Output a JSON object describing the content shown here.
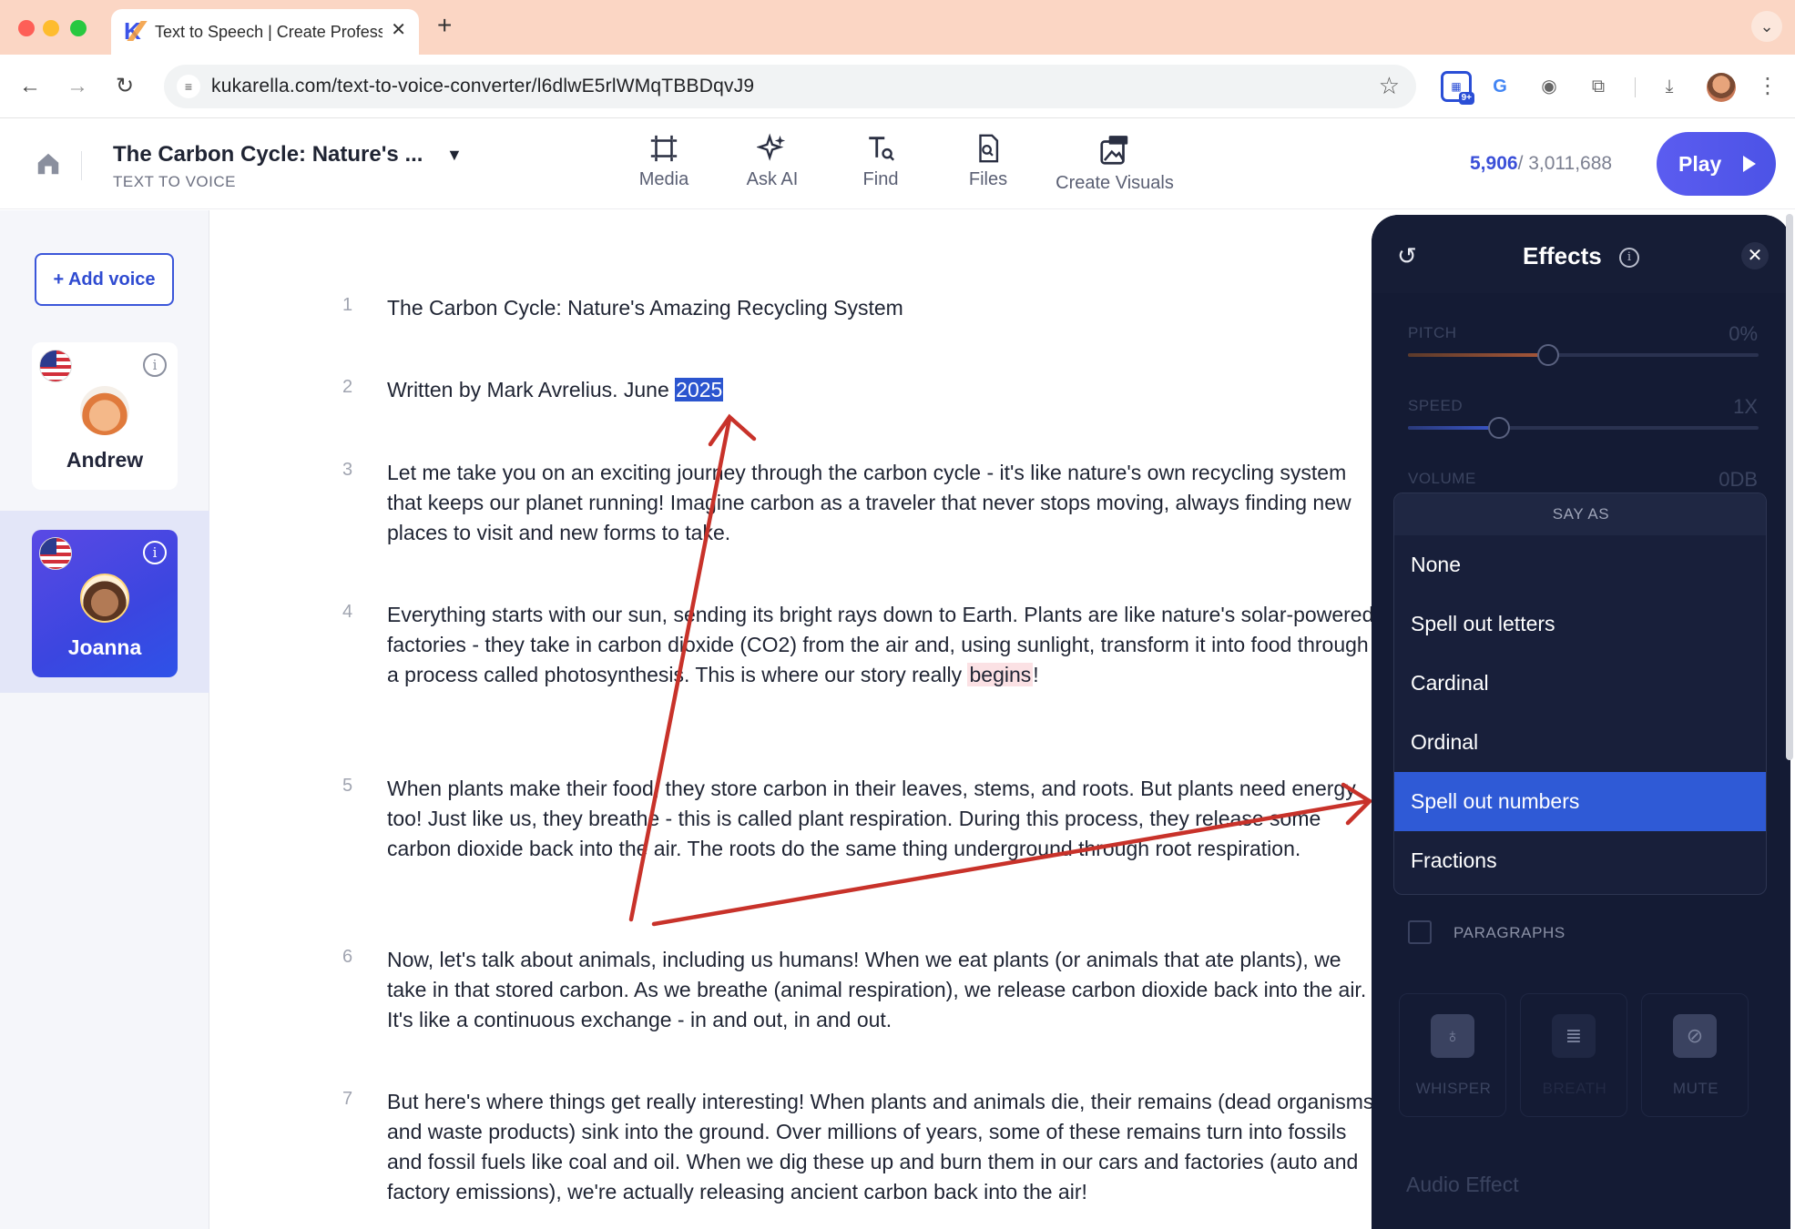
{
  "browser": {
    "tab_title": "Text to Speech | Create Professional",
    "tab_favicon": "K",
    "url": "kukarella.com/text-to-voice-converter/l6dlwE5rlWMqTBBDqvJ9",
    "extension_badge": "9+"
  },
  "header": {
    "doc_title": "The Carbon Cycle: Nature's ...",
    "doc_subtitle": "TEXT TO VOICE",
    "tools": [
      {
        "label": "Media",
        "icon": "media-frame-icon"
      },
      {
        "label": "Ask AI",
        "icon": "sparkles-icon"
      },
      {
        "label": "Find",
        "icon": "find-text-icon"
      },
      {
        "label": "Files",
        "icon": "files-icon"
      },
      {
        "label": "Create Visuals",
        "icon": "create-visuals-icon"
      }
    ],
    "chars_used": "5,906",
    "chars_total": "/ 3,011,688",
    "play_label": "Play"
  },
  "sidebar": {
    "add_voice_label": "+ Add voice",
    "voices": [
      {
        "name": "Andrew",
        "selected": false
      },
      {
        "name": "Joanna",
        "selected": true
      }
    ]
  },
  "editor": {
    "paragraphs": [
      {
        "number": "1",
        "text": "The Carbon Cycle: Nature's Amazing Recycling System"
      },
      {
        "number": "2",
        "before": "Written by Mark Avrelius. June ",
        "selected": "2025"
      },
      {
        "number": "3",
        "text": "Let me take you on an exciting journey through the carbon cycle - it's like nature's own recycling system that keeps our planet running! Imagine carbon as a traveler that never stops moving, always finding new places to visit and new forms to take."
      },
      {
        "number": "4",
        "before": "Everything starts with our sun, sending its bright rays down to Earth. Plants are like nature's solar-powered factories - they take in carbon dioxide (CO2) from the air and, using sunlight, transform it into food through a process called photosynthesis. This is where our story really ",
        "highlight": "begins",
        "after": "!"
      },
      {
        "number": "5",
        "text": "When plants make their food, they store carbon in their leaves, stems, and roots. But plants need energy too! Just like us, they breathe - this is called plant respiration. During this process, they release some carbon dioxide back into the air. The roots do the same thing underground through root respiration."
      },
      {
        "number": "6",
        "text": "Now, let's talk about animals, including us humans! When we eat plants (or animals that ate plants), we take in that stored carbon. As we breathe (animal respiration), we release carbon dioxide back into the air. It's like a continuous exchange - in and out, in and out."
      },
      {
        "number": "7",
        "text": "But here's where things get really interesting! When plants and animals die, their remains (dead organisms and waste products) sink into the ground. Over millions of years, some of these remains turn into fossils and fossil fuels like coal and oil. When we dig these up and burn them in our cars and factories (auto and factory emissions), we're actually releasing ancient carbon back into the air!"
      }
    ]
  },
  "effects": {
    "title": "Effects",
    "pitch": {
      "label": "PITCH",
      "value": "0%",
      "level": 0.4
    },
    "speed": {
      "label": "SPEED",
      "value": "1X",
      "level": 0.26
    },
    "volume": {
      "label": "VOLUME",
      "value": "0DB"
    },
    "say_as": {
      "header": "SAY AS",
      "options": [
        "None",
        "Spell out letters",
        "Cardinal",
        "Ordinal",
        "Spell out numbers",
        "Fractions"
      ],
      "selected": "Spell out numbers"
    },
    "paragraphs_label": "PARAGRAPHS",
    "buttons": [
      {
        "label": "WHISPER",
        "icon": "whisper-ear-icon"
      },
      {
        "label": "BREATH",
        "icon": "breath-lines-icon"
      },
      {
        "label": "MUTE",
        "icon": "mute-mic-icon"
      }
    ],
    "audio_effect_label": "Audio Effect"
  },
  "colors": {
    "accent": "#3b56d9",
    "selection": "#2b55cf",
    "panel_bg": "#141b34",
    "annotation_arrow": "#c8322a"
  }
}
